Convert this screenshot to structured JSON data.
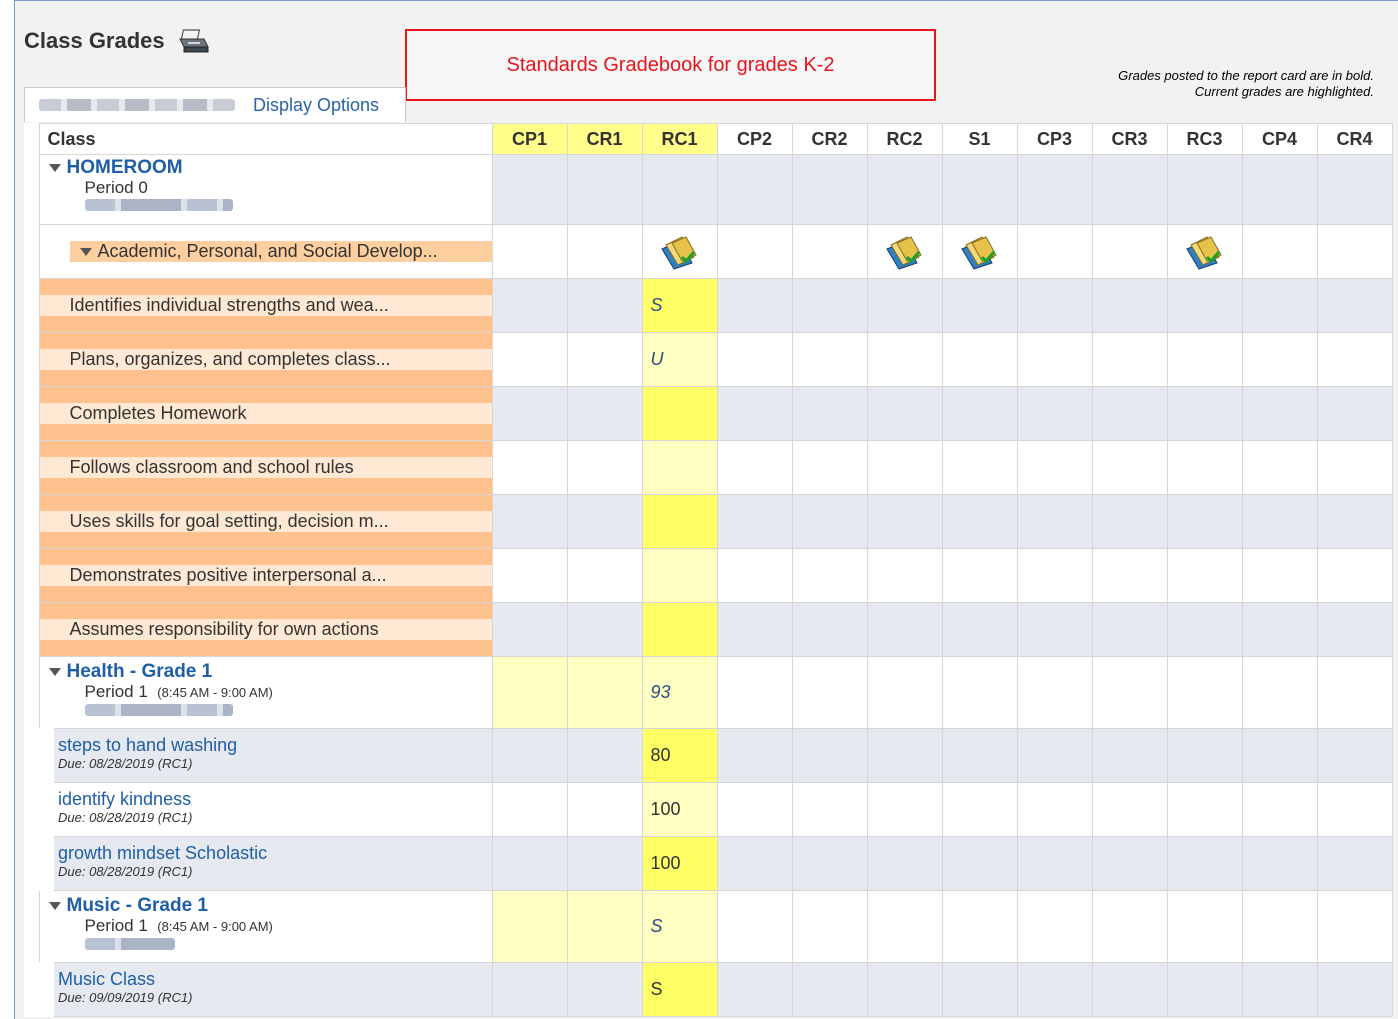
{
  "page": {
    "title": "Class Grades",
    "banner": "Standards Gradebook for grades K-2",
    "legend_line1": "Grades posted to the report card are in bold.",
    "legend_line2": "Current grades are highlighted.",
    "display_options": "Display Options"
  },
  "columns": {
    "class": "Class",
    "terms": [
      "CP1",
      "CR1",
      "RC1",
      "CP2",
      "CR2",
      "RC2",
      "S1",
      "CP3",
      "CR3",
      "RC3",
      "CP4",
      "CR4"
    ]
  },
  "homeroom": {
    "name": "HOMEROOM",
    "period": "Period 0",
    "standard_group": "Academic, Personal, and Social Develop...",
    "standards": [
      {
        "text": "Identifies individual strengths and wea...",
        "rc1": "S"
      },
      {
        "text": "Plans, organizes, and completes class...",
        "rc1": "U"
      },
      {
        "text": "Completes Homework",
        "rc1": ""
      },
      {
        "text": "Follows classroom and school rules",
        "rc1": ""
      },
      {
        "text": "Uses skills for goal setting, decision m...",
        "rc1": ""
      },
      {
        "text": "Demonstrates positive interpersonal a...",
        "rc1": ""
      },
      {
        "text": "Assumes responsibility for own actions",
        "rc1": ""
      }
    ]
  },
  "health": {
    "name": "Health - Grade 1",
    "period": "Period 1",
    "time": "(8:45 AM - 9:00 AM)",
    "rc1": "93",
    "assignments": [
      {
        "name": "steps to hand washing",
        "due": "Due: 08/28/2019  (RC1)",
        "rc1": "80"
      },
      {
        "name": "identify kindness",
        "due": "Due: 08/28/2019  (RC1)",
        "rc1": "100"
      },
      {
        "name": "growth mindset Scholastic",
        "due": "Due: 08/28/2019  (RC1)",
        "rc1": "100"
      }
    ]
  },
  "music": {
    "name": "Music - Grade 1",
    "period": "Period 1",
    "time": "(8:45 AM - 9:00 AM)",
    "rc1": "S",
    "assignments": [
      {
        "name": "Music Class",
        "due": "Due: 09/09/2019  (RC1)",
        "rc1": "S"
      }
    ]
  },
  "icons": {
    "print": "printer-icon",
    "standards_book": "standards-book-icon",
    "collapse": "triangle-down-icon"
  },
  "colors": {
    "link": "#1f5ea8",
    "banner_red": "#e8151c",
    "highlight_yellow": "#ffff99",
    "standard_orange": "#ffc28f"
  }
}
